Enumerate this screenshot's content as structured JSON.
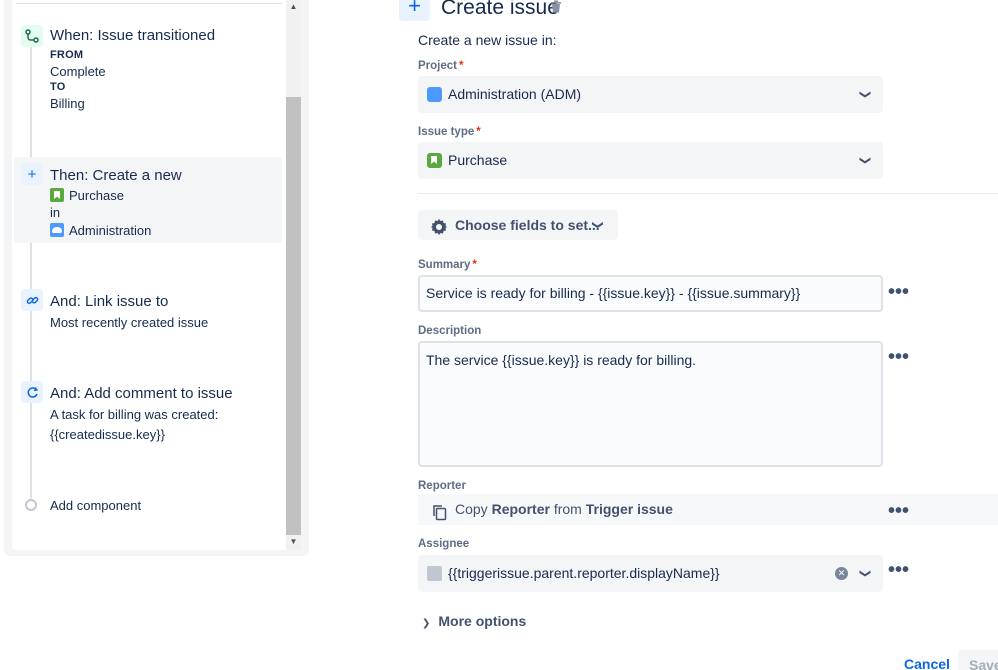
{
  "rule": {
    "trigger": {
      "title": "When: Issue transitioned",
      "from_label": "FROM",
      "from_value": "Complete",
      "to_label": "TO",
      "to_value": "Billing"
    },
    "create": {
      "title": "Then: Create a new",
      "issue_type": "Purchase",
      "in_label": "in",
      "project": "Administration"
    },
    "link": {
      "title": "And: Link issue to",
      "detail": "Most recently created issue"
    },
    "comment": {
      "title": "And: Add comment to issue",
      "line1": "A task for billing was created:",
      "line2": "{{createdissue.key}}"
    },
    "add_component": "Add component"
  },
  "config": {
    "heading": "Create issue",
    "intro": "Create a new issue in:",
    "project_label": "Project",
    "project_value": "Administration (ADM)",
    "issue_type_label": "Issue type",
    "issue_type_value": "Purchase",
    "choose_fields": "Choose fields to set...",
    "summary_label": "Summary",
    "summary_value": "Service is ready for billing - {{issue.key}} - {{issue.summary}}",
    "description_label": "Description",
    "description_value": "The service {{issue.key}} is ready for billing.",
    "reporter_label": "Reporter",
    "reporter_copy": "Copy",
    "reporter_field": "Reporter",
    "reporter_from": "from",
    "reporter_source": "Trigger issue",
    "assignee_label": "Assignee",
    "assignee_value": "{{triggerissue.parent.reporter.displayName}}",
    "more_options": "More options",
    "cancel": "Cancel",
    "save": "Save",
    "required_mark": "*",
    "more_dots": "•••"
  },
  "colors": {
    "accent": "#0c66e4",
    "required": "#de350b",
    "purchase_icon": "#5aa93e",
    "project_icon": "#4c9aff"
  },
  "icons": [
    "trigger-branch-icon",
    "plus-icon",
    "link-icon",
    "comment-refresh-icon",
    "trash-icon",
    "gear-icon",
    "chevron-down-icon",
    "copy-icon",
    "clear-icon",
    "chevron-right-icon"
  ]
}
